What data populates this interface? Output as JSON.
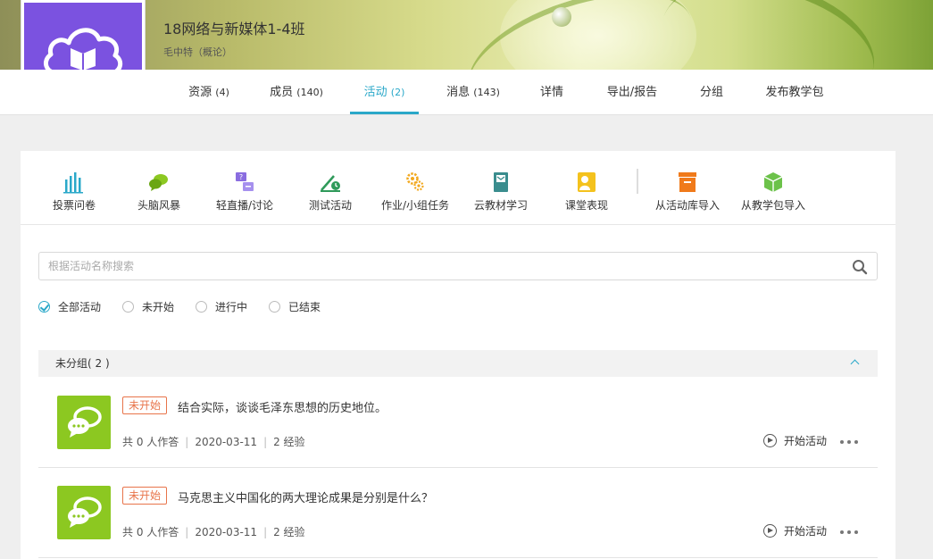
{
  "course": {
    "title": "18网络与新媒体1-4班",
    "teacher": "毛中特（概论）"
  },
  "tabs": [
    {
      "label": "资源",
      "count": "(4)"
    },
    {
      "label": "成员",
      "count": "(140)"
    },
    {
      "label": "活动",
      "count": "(2)"
    },
    {
      "label": "消息",
      "count": "(143)"
    },
    {
      "label": "详情",
      "count": ""
    },
    {
      "label": "导出/报告",
      "count": ""
    },
    {
      "label": "分组",
      "count": ""
    },
    {
      "label": "发布教学包",
      "count": ""
    }
  ],
  "active_tab": "活动",
  "toolbar": [
    {
      "label": "投票问卷",
      "icon": "bar-chart-icon"
    },
    {
      "label": "头脑风暴",
      "icon": "chat-bubbles-icon"
    },
    {
      "label": "轻直播/讨论",
      "icon": "live-discussion-icon"
    },
    {
      "label": "测试活动",
      "icon": "test-icon"
    },
    {
      "label": "作业/小组任务",
      "icon": "gears-icon"
    },
    {
      "label": "云教材学习",
      "icon": "book-icon"
    },
    {
      "label": "课堂表现",
      "icon": "person-icon"
    },
    {
      "label": "从活动库导入",
      "icon": "archive-icon"
    },
    {
      "label": "从教学包导入",
      "icon": "package-icon"
    }
  ],
  "search": {
    "placeholder": "根据活动名称搜索",
    "value": ""
  },
  "filters": [
    {
      "label": "全部活动",
      "checked": true
    },
    {
      "label": "未开始",
      "checked": false
    },
    {
      "label": "进行中",
      "checked": false
    },
    {
      "label": "已结束",
      "checked": false
    }
  ],
  "group": {
    "label": "未分组( 2 )"
  },
  "activities": [
    {
      "status": "未开始",
      "title": "结合实际，谈谈毛泽东思想的历史地位。",
      "participants": "共 0 人作答",
      "date": "2020-03-11",
      "exp": "2 经验",
      "action": "开始活动"
    },
    {
      "status": "未开始",
      "title": "马克思主义中国化的两大理论成果是分别是什么？",
      "participants": "共 0 人作答",
      "date": "2020-03-11",
      "exp": "2 经验",
      "action": "开始活动"
    }
  ],
  "colors": {
    "accent": "#2aa8c9",
    "logo_bg": "#7b52e0",
    "activity_icon_bg": "#8cc821",
    "status_not_started": "#e8744a"
  }
}
